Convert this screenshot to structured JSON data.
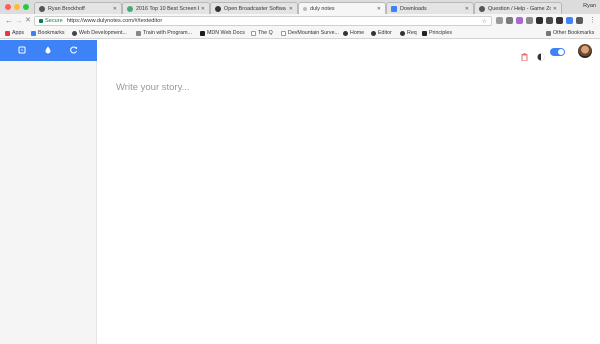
{
  "browser": {
    "profile_name": "Ryan",
    "tabs": [
      {
        "label": "Ryan Brockhoff",
        "icon": "github-icon",
        "active": false
      },
      {
        "label": "2016 Top 10 Best Screen R",
        "icon": "page-icon",
        "active": false
      },
      {
        "label": "Open Broadcaster Softwa",
        "icon": "obs-icon",
        "active": false
      },
      {
        "label": "duly notes",
        "icon": "page-icon",
        "active": true
      },
      {
        "label": "Downloads",
        "icon": "download-icon",
        "active": false
      },
      {
        "label": "Question / Help - Game Zo",
        "icon": "github-icon",
        "active": false
      }
    ],
    "address": {
      "secure_label": "Secure",
      "url": "https://www.dulynotes.com/#/texteditor"
    },
    "bookmarks": [
      {
        "label": "Apps"
      },
      {
        "label": "Bookmarks"
      },
      {
        "label": "Web Development..."
      },
      {
        "label": "Train with Program..."
      },
      {
        "label": "MDN Web Docs"
      },
      {
        "label": "The Q"
      },
      {
        "label": "DevMountain Surve..."
      },
      {
        "label": "Home"
      },
      {
        "label": "Editor"
      },
      {
        "label": "Req"
      },
      {
        "label": "Principles"
      }
    ],
    "other_bookmarks": "Other Bookmarks"
  },
  "app": {
    "sidebar_buttons": [
      "new-note-icon",
      "drop-icon",
      "refresh-icon"
    ],
    "accent_color": "#3e82f7",
    "editor": {
      "placeholder": "Write your story..."
    },
    "theme_toggle_on": true
  }
}
